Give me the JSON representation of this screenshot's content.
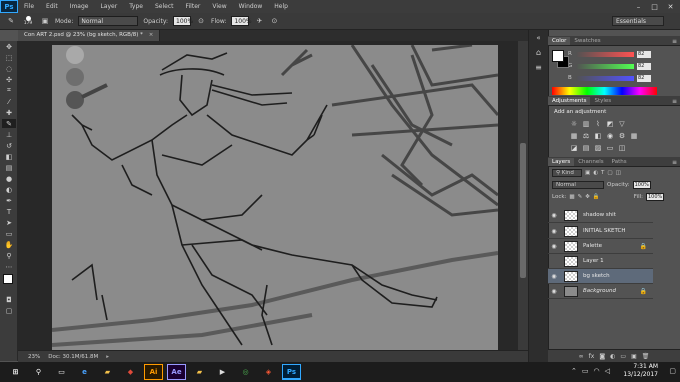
{
  "menubar": {
    "logo": "Ps",
    "items": [
      "File",
      "Edit",
      "Image",
      "Layer",
      "Type",
      "Select",
      "Filter",
      "View",
      "Window",
      "Help"
    ]
  },
  "options": {
    "brush_size": "179",
    "mode_label": "Mode:",
    "mode_value": "Normal",
    "opacity_label": "Opacity:",
    "opacity_value": "100%",
    "flow_label": "Flow:",
    "flow_value": "100%",
    "workspace": "Essentials"
  },
  "document": {
    "tab_title": "Con ART 2.psd @ 23% (bg sketch, RGB/8) *",
    "zoom": "23%",
    "doc_info": "Doc: 30.1M/61.8M"
  },
  "color_panel": {
    "tabs": [
      "Color",
      "Swatches"
    ],
    "channels": [
      {
        "name": "R",
        "value": "82"
      },
      {
        "name": "G",
        "value": "82"
      },
      {
        "name": "B",
        "value": "82"
      }
    ]
  },
  "adjustments_panel": {
    "tabs": [
      "Adjustments",
      "Styles"
    ],
    "heading": "Add an adjustment"
  },
  "layers_panel": {
    "tabs": [
      "Layers",
      "Channels",
      "Paths"
    ],
    "kind": "Kind",
    "blend_mode": "Normal",
    "opacity_label": "Opacity:",
    "opacity_value": "100%",
    "lock_label": "Lock:",
    "fill_label": "Fill:",
    "fill_value": "100%",
    "layers": [
      {
        "name": "shadow shit",
        "locked": false,
        "selected": false
      },
      {
        "name": "INITIAL SKETCH",
        "locked": false,
        "selected": false
      },
      {
        "name": "Palette",
        "locked": true,
        "selected": false
      },
      {
        "name": "Layer 1",
        "locked": false,
        "selected": false
      },
      {
        "name": "bg sketch",
        "locked": false,
        "selected": true
      },
      {
        "name": "Background",
        "locked": true,
        "selected": false
      }
    ]
  },
  "taskbar": {
    "time": "7:31 AM",
    "date": "13/12/2017",
    "apps": [
      {
        "label": "Ai",
        "color": "#ff9a00"
      },
      {
        "label": "Ae",
        "color": "#9999ff"
      },
      {
        "label": "Ps",
        "color": "#31a8ff"
      }
    ]
  },
  "colors": {
    "canvas_gray": "#8b8b8b",
    "selected_layer": "#5e6a7a",
    "panel_bg": "#535353"
  }
}
